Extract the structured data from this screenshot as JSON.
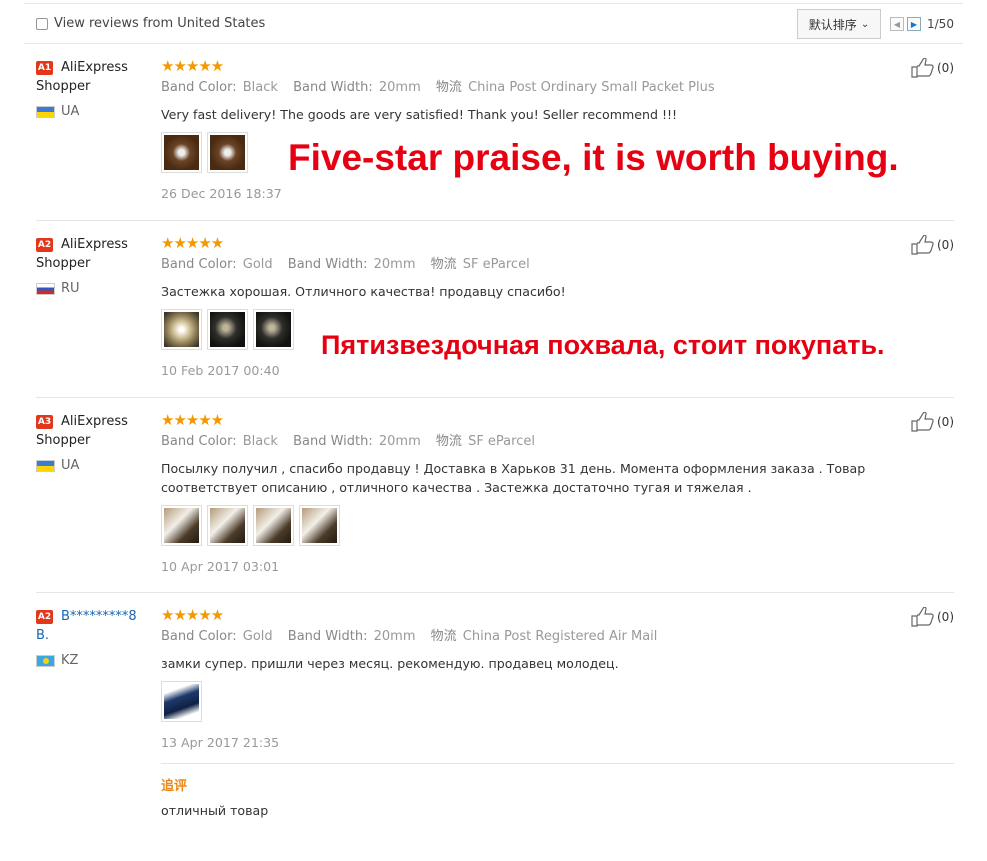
{
  "filter": {
    "label": "View reviews from United States"
  },
  "sort": {
    "label": "默认排序"
  },
  "pager": {
    "page": "1/50"
  },
  "labels": {
    "band_color": "Band Color:",
    "band_width": "Band Width:",
    "logistics": "物流"
  },
  "overlays": {
    "english": "Five-star praise, it is worth buying.",
    "russian": "Пятизвездочная похвала, стоит покупать."
  },
  "reviews": [
    {
      "level": "A1",
      "user": "AliExpress",
      "user2": "Shopper",
      "country": "UA",
      "stars": "★★★★★",
      "band_color": "Black",
      "band_width": "20mm",
      "shipping": "China Post Ordinary Small Packet Plus",
      "text": "Very fast delivery! The goods are very satisfied! Thank you! Seller recommend !!!",
      "date": "26 Dec 2016 18:37",
      "likes": "(0)"
    },
    {
      "level": "A2",
      "user": "AliExpress",
      "user2": "Shopper",
      "country": "RU",
      "stars": "★★★★★",
      "band_color": "Gold",
      "band_width": "20mm",
      "shipping": "SF eParcel",
      "text": "Застежка хорошая. Отличного качества! продавцу спасибо!",
      "date": "10 Feb 2017 00:40",
      "likes": "(0)"
    },
    {
      "level": "A3",
      "user": "AliExpress",
      "user2": "Shopper",
      "country": "UA",
      "stars": "★★★★★",
      "band_color": "Black",
      "band_width": "20mm",
      "shipping": "SF eParcel",
      "text": "Посылку получил , спасибо продавцу ! Доставка в Харьков 31 день. Момента оформления заказа . Товар соответствует описанию , отличного качества . Застежка достаточно тугая и тяжелая .",
      "date": "10 Apr 2017 03:01",
      "likes": "(0)"
    },
    {
      "level": "A2",
      "user": "B*********8",
      "user2": "B.",
      "country": "KZ",
      "stars": "★★★★★",
      "band_color": "Gold",
      "band_width": "20mm",
      "shipping": "China Post Registered Air Mail",
      "text": "замки супер. пришли через месяц. рекомендую. продавец молодец.",
      "date": "13 Apr 2017 21:35",
      "likes": "(0)",
      "additional_title": "追评",
      "additional_text": "отличный товар"
    }
  ],
  "icons": {
    "like": "thumbs-up-icon",
    "prev": "prev-arrow-icon",
    "next": "next-arrow-icon"
  },
  "colors": {
    "stars": "#f39800",
    "overlay": "#e60012",
    "level_badge": "#e2371b",
    "link": "#1766b3"
  }
}
